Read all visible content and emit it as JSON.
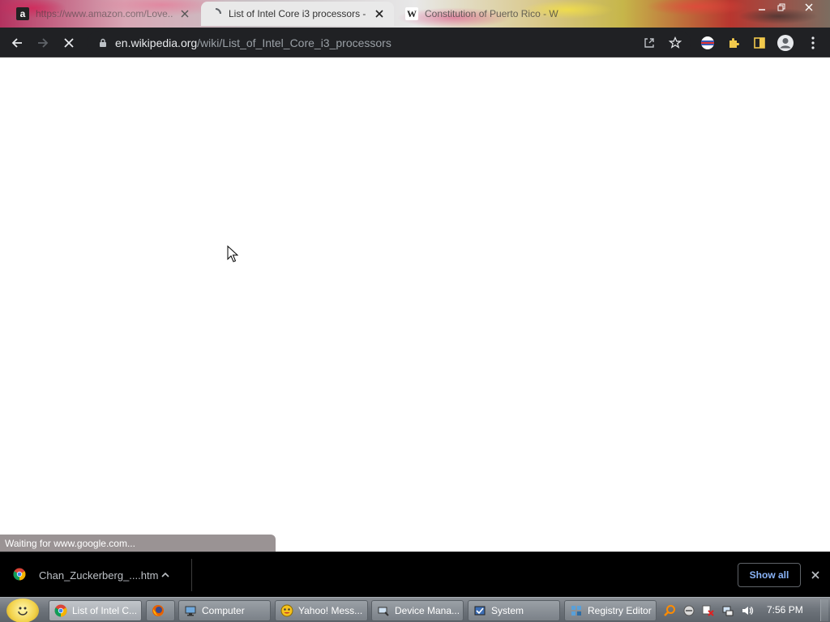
{
  "tabs": [
    {
      "title": "https://www.amazon.com/Love...",
      "favicon": "amazon-icon",
      "active": false
    },
    {
      "title": "List of Intel Core i3 processors -",
      "favicon": "loading-spinner-icon",
      "active": true
    },
    {
      "title": "Constitution of Puerto Rico - W",
      "favicon": "wikipedia-icon",
      "active": false
    }
  ],
  "address": {
    "host": "en.wikipedia.org",
    "path": "/wiki/List_of_Intel_Core_i3_processors"
  },
  "status_text": "Waiting for www.google.com...",
  "download": {
    "filename": "Chan_Zuckerberg_....htm",
    "show_all": "Show all"
  },
  "taskbar": {
    "items": [
      {
        "label": "List of Intel C...",
        "icon": "chrome-icon",
        "active": true
      },
      {
        "label": "",
        "icon": "firefox-icon",
        "active": false
      },
      {
        "label": "Computer",
        "icon": "computer-icon",
        "active": false
      },
      {
        "label": "Yahoo! Mess...",
        "icon": "yahoo-messenger-icon",
        "active": false
      },
      {
        "label": "Device Mana...",
        "icon": "device-manager-icon",
        "active": false
      },
      {
        "label": "System",
        "icon": "system-icon",
        "active": false
      },
      {
        "label": "Registry Editor",
        "icon": "registry-editor-icon",
        "active": false
      }
    ],
    "clock": "7:56 PM"
  },
  "colors": {
    "toolbar_bg": "#202124",
    "link_blue": "#8ab4f8",
    "status_bg": "#9a9394"
  }
}
